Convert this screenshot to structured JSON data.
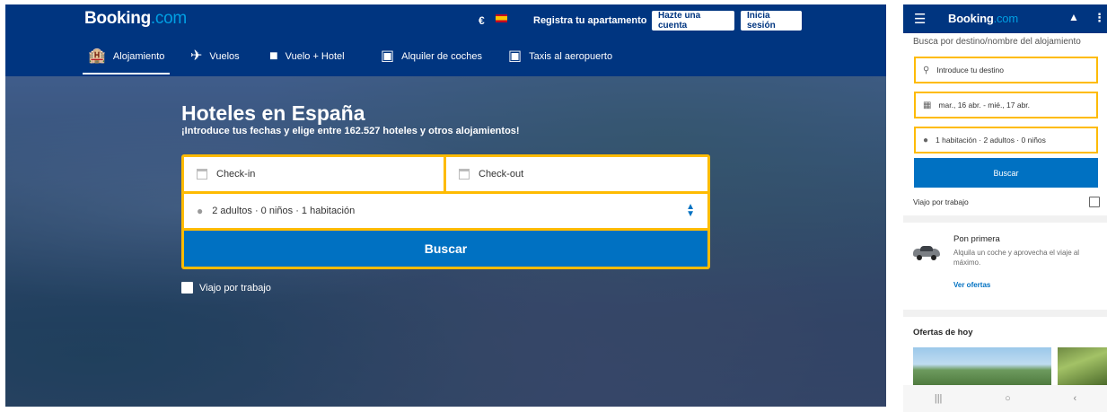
{
  "desktop": {
    "header": {
      "logo": {
        "brand": "Booking",
        "suffix": ".com"
      },
      "currency": "€",
      "flag_icon": "spain-flag-icon",
      "register_property": "Registra tu apartamento",
      "create_account": "Hazte una cuenta",
      "login": "Inicia sesión"
    },
    "nav": [
      {
        "label": "Alojamiento",
        "icon": "bed-building-icon",
        "active": true
      },
      {
        "label": "Vuelos",
        "icon": "plane-icon",
        "active": false
      },
      {
        "label": "Vuelo + Hotel",
        "icon": "suitcase-icon",
        "active": false
      },
      {
        "label": "Alquiler de coches",
        "icon": "car-icon",
        "active": false
      },
      {
        "label": "Taxis al aeropuerto",
        "icon": "taxi-icon",
        "active": false
      }
    ],
    "hero": {
      "title": "Hoteles en España",
      "subtitle": "¡Introduce tus fechas y elige entre 162.527 hoteles y otros alojamientos!"
    },
    "search": {
      "checkin_placeholder": "Check-in",
      "checkout_placeholder": "Check-out",
      "guests": "2 adultos  ·  0 niños  ·  1 habitación",
      "submit": "Buscar",
      "work_trip": "Viajo por trabajo"
    },
    "colors": {
      "brand_blue": "#003580",
      "accent_yellow": "#febb02",
      "button_blue": "#0071c2"
    }
  },
  "mobile": {
    "header": {
      "menu_icon": "hamburger-icon",
      "logo_brand": "Booking",
      "logo_suffix": ".com",
      "bell_icon": "bell-icon",
      "more_icon": "kebab-icon"
    },
    "search_label": "Busca por destino/nombre del alojamiento",
    "destination_placeholder": "Introduce tu destino",
    "dates": "mar., 16 abr. - mié., 17 abr.",
    "guests": "1 habitación · 2 adultos · 0 niños",
    "submit": "Buscar",
    "work_trip": "Viajo por trabajo",
    "promo": {
      "title": "Pon primera",
      "text": "Alquila un coche y aprovecha el viaje al máximo.",
      "link": "Ver ofertas"
    },
    "deals_title": "Ofertas de hoy",
    "system_nav": [
      "|||",
      "○",
      "‹"
    ]
  }
}
